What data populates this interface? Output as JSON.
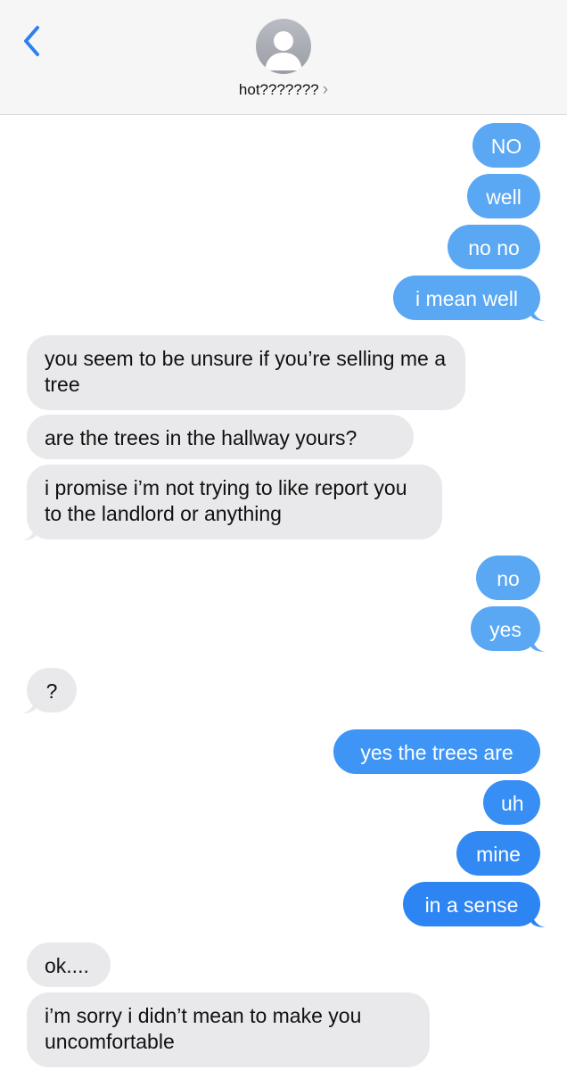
{
  "header": {
    "contact_name": "hot???????",
    "chevron": "›",
    "back_icon": "chevron-left-icon",
    "avatar_icon": "person-silhouette-icon"
  },
  "colors": {
    "sent_top": "#5aa7f3",
    "sent_bottom": "#2f8bf5",
    "received": "#e9e9eb",
    "header_bg": "#f6f6f6",
    "back_arrow": "#2f7ff3"
  },
  "messages": [
    {
      "from": "me",
      "text": "NO"
    },
    {
      "from": "me",
      "text": "well"
    },
    {
      "from": "me",
      "text": "no no"
    },
    {
      "from": "me",
      "text": "i mean well"
    },
    {
      "from": "them",
      "text": "you seem to be unsure if you’re selling me a tree"
    },
    {
      "from": "them",
      "text": "are the trees in the hallway yours?"
    },
    {
      "from": "them",
      "text": "i promise i’m not trying to like report you to the landlord or anything"
    },
    {
      "from": "me",
      "text": "no"
    },
    {
      "from": "me",
      "text": "yes"
    },
    {
      "from": "them",
      "text": "?"
    },
    {
      "from": "me",
      "text": "yes the trees are"
    },
    {
      "from": "me",
      "text": "uh"
    },
    {
      "from": "me",
      "text": "mine"
    },
    {
      "from": "me",
      "text": "in a sense"
    },
    {
      "from": "them",
      "text": "ok...."
    },
    {
      "from": "them",
      "text": "i’m sorry i didn’t mean to make you uncomfortable"
    }
  ]
}
